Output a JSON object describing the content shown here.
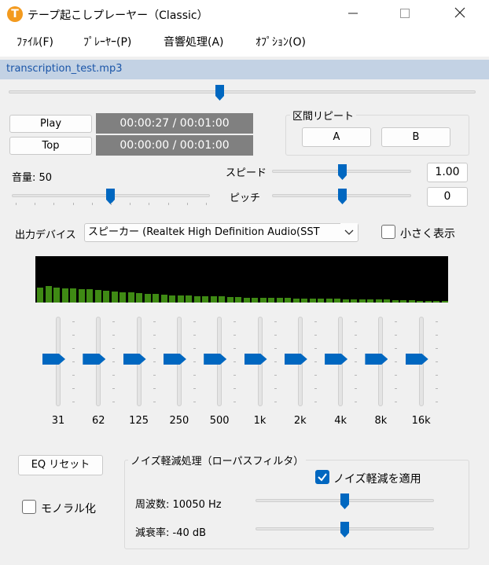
{
  "window": {
    "icon_letter": "T",
    "title": "テープ起こしプレーヤー（Classic）",
    "minimize_icon": "minimize-icon",
    "maximize_icon": "maximize-icon",
    "close_icon": "close-icon"
  },
  "menu": [
    "ﾌｧｲﾙ(F)",
    "ﾌﾟﾚｰﾔｰ(P)",
    "音響処理(A)",
    "ｵﾌﾟｼｮﾝ(O)"
  ],
  "file": {
    "name": "transcription_test.mp3"
  },
  "position_slider": {
    "value_fraction": 0.45
  },
  "transport": {
    "play_label": "Play",
    "top_label": "Top",
    "current_time": "00:00:27 / 00:01:00",
    "start_time": "00:00:00 / 00:01:00"
  },
  "repeat": {
    "title": "区間リピート",
    "a_label": "A",
    "b_label": "B"
  },
  "volume": {
    "label": "音量: 50",
    "value_fraction": 0.5
  },
  "speed": {
    "label": "スピード",
    "value": "1.00",
    "value_fraction": 0.5
  },
  "pitch": {
    "label": "ピッチ",
    "value": "0",
    "value_fraction": 0.5
  },
  "output": {
    "label": "出力デバイス",
    "selected": "スピーカー (Realtek High Definition Audio(SST",
    "compact_label": "小さく表示",
    "compact_checked": false
  },
  "spectrum": {
    "levels": [
      0.33,
      0.36,
      0.32,
      0.3,
      0.31,
      0.28,
      0.29,
      0.27,
      0.25,
      0.24,
      0.22,
      0.22,
      0.2,
      0.19,
      0.18,
      0.17,
      0.16,
      0.16,
      0.15,
      0.14,
      0.14,
      0.13,
      0.13,
      0.12,
      0.12,
      0.11,
      0.11,
      0.11,
      0.1,
      0.1,
      0.1,
      0.09,
      0.09,
      0.09,
      0.08,
      0.08,
      0.08,
      0.07,
      0.07,
      0.07,
      0.06,
      0.06,
      0.06,
      0.05,
      0.05,
      0.05,
      0.04,
      0.04,
      0.04,
      0.03
    ]
  },
  "eq": {
    "bands": [
      "31",
      "62",
      "125",
      "250",
      "500",
      "1k",
      "2k",
      "4k",
      "8k",
      "16k"
    ],
    "levels": [
      0,
      0,
      0,
      0,
      0,
      0,
      0,
      0,
      0,
      0
    ]
  },
  "eq_reset_label": "EQ リセット",
  "mono_label": "モノラル化",
  "mono_checked": false,
  "noise": {
    "title": "ノイズ軽減処理（ローパスフィルタ）",
    "apply_label": "ノイズ軽減を適用",
    "apply_checked": true,
    "frequency_label": "周波数: 10050 Hz",
    "frequency_fraction": 0.5,
    "attenuation_label": "減衰率: -40 dB",
    "attenuation_fraction": 0.5
  },
  "colors": {
    "accent": "#0067c0",
    "time_box": "#808080",
    "spectrum_bar": "#3f8a14",
    "filebar": "#c3d2e4"
  }
}
